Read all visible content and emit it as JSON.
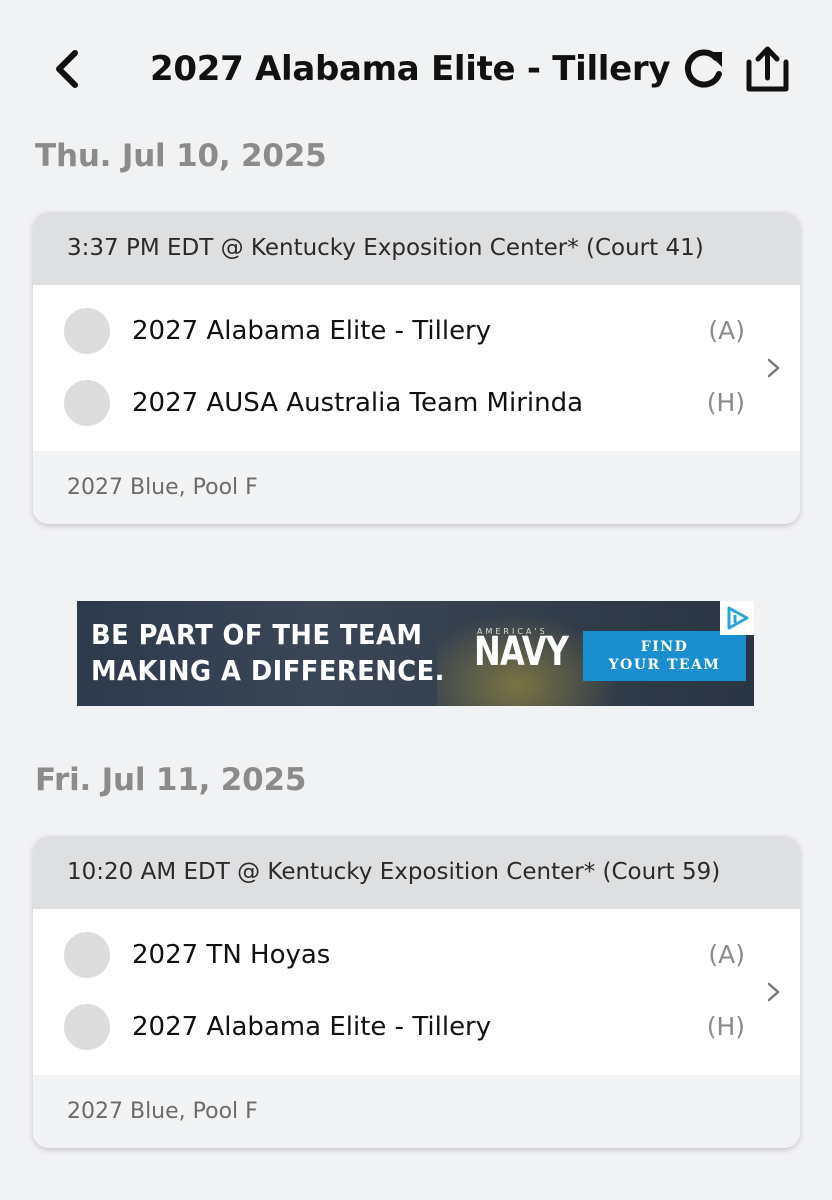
{
  "header": {
    "title": "2027 Alabama Elite - Tillery",
    "back_icon": "chevron-left-icon",
    "refresh_icon": "refresh-icon",
    "share_icon": "share-icon"
  },
  "days": [
    {
      "date": "Thu. Jul 10, 2025",
      "match": {
        "time_location": "3:37 PM EDT @ Kentucky Exposition Center* (Court 41)",
        "teams": [
          {
            "name": "2027 Alabama Elite - Tillery",
            "side": "(A)"
          },
          {
            "name": "2027 AUSA Australia Team Mirinda",
            "side": "(H)"
          }
        ],
        "division": "2027 Blue, Pool F"
      }
    },
    {
      "date": "Fri. Jul 11, 2025",
      "match": {
        "time_location": "10:20 AM EDT @ Kentucky Exposition Center* (Court 59)",
        "teams": [
          {
            "name": "2027 TN Hoyas",
            "side": "(A)"
          },
          {
            "name": "2027 Alabama Elite - Tillery",
            "side": "(H)"
          }
        ],
        "division": "2027 Blue, Pool F"
      }
    }
  ],
  "ad": {
    "line1": "BE PART OF THE TEAM",
    "line2": "MAKING A DIFFERENCE.",
    "brand_top": "AMERICA'S",
    "brand": "NAVY",
    "cta_line1": "FIND",
    "cta_line2": "YOUR TEAM"
  },
  "colors": {
    "background": "#f1f2f4",
    "card_header": "#dedfe1",
    "card_footer": "#f2f3f5",
    "muted_text": "#8b8b8b",
    "ad_cta": "#1a8fd0"
  }
}
